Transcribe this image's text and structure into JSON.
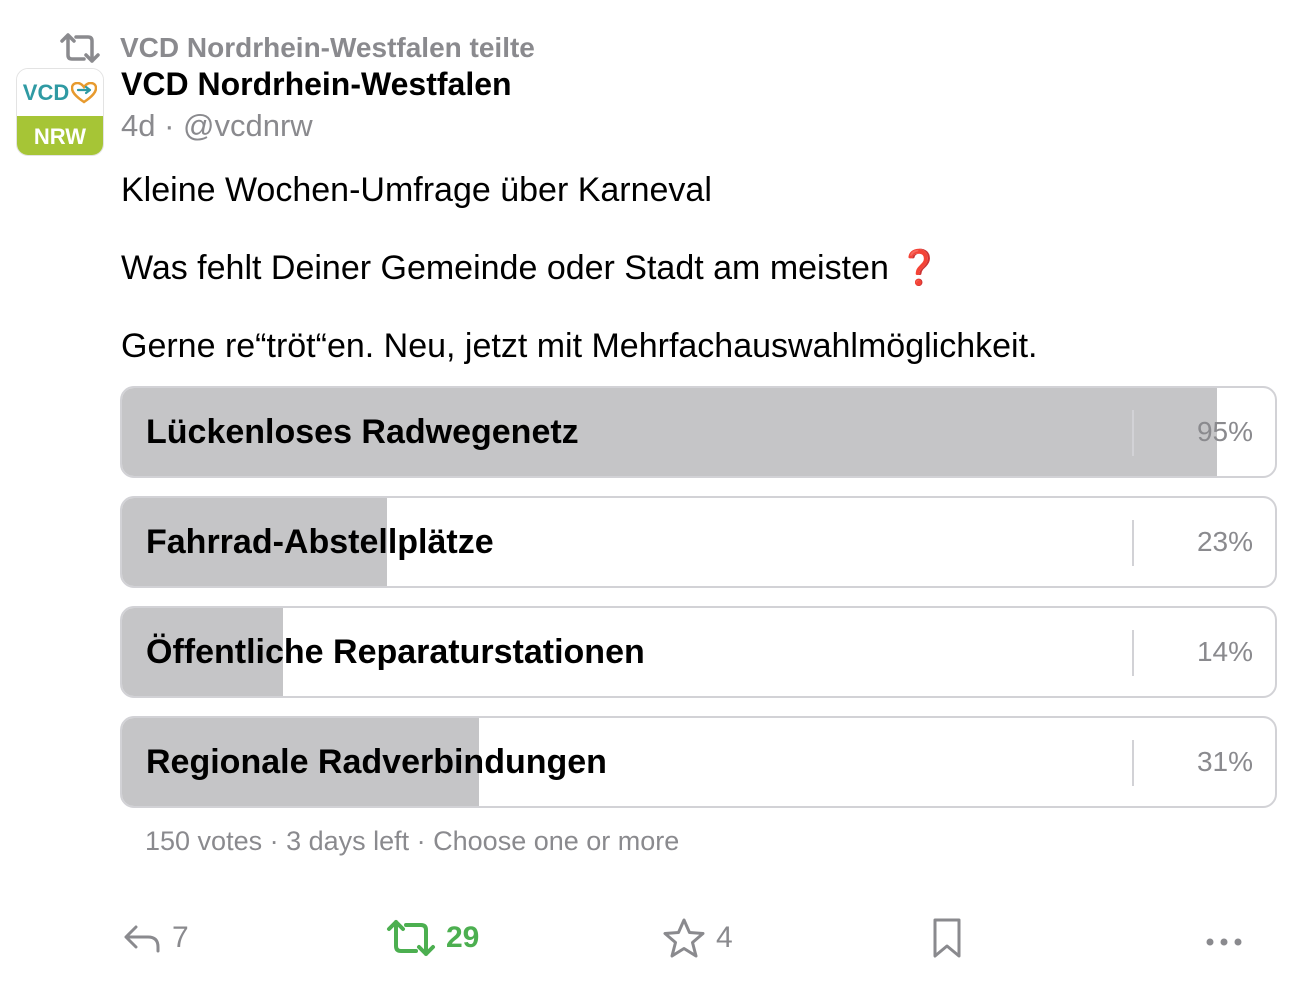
{
  "reblog": {
    "text": "VCD Nordrhein-Westfalen teilte",
    "icon": "boost-icon"
  },
  "account": {
    "display_name": "VCD Nordrhein-Westfalen",
    "avatar_top": "VCD",
    "avatar_bottom": "NRW",
    "meta": "4d · @vcdnrw"
  },
  "post": {
    "line1": "Kleine Wochen-Umfrage über Karneval",
    "line2": "Was fehlt Deiner Gemeinde oder Stadt am meisten",
    "line2_emoji": "❓",
    "line3": "Gerne re“tröt“en. Neu, jetzt mit Mehrfachauswahlmöglichkeit."
  },
  "poll": {
    "options": [
      {
        "label": "Lückenloses Radwegenetz",
        "percent": 95,
        "percent_text": "95%"
      },
      {
        "label": "Fahrrad-Abstellplätze",
        "percent": 23,
        "percent_text": "23%"
      },
      {
        "label": "Öffentliche Reparaturstationen",
        "percent": 14,
        "percent_text": "14%"
      },
      {
        "label": "Regionale Radverbindungen",
        "percent": 31,
        "percent_text": "31%"
      }
    ],
    "footer": "150 votes · 3 days left · Choose one or more"
  },
  "actions": {
    "reply_count": "7",
    "boost_count": "29",
    "favourite_count": "4"
  },
  "colors": {
    "secondary_text": "#8a8a8e",
    "poll_fill": "#c5c5c7",
    "boost_active": "#4caf50",
    "avatar_green": "#a6c536",
    "avatar_teal": "#2f9aa3"
  }
}
